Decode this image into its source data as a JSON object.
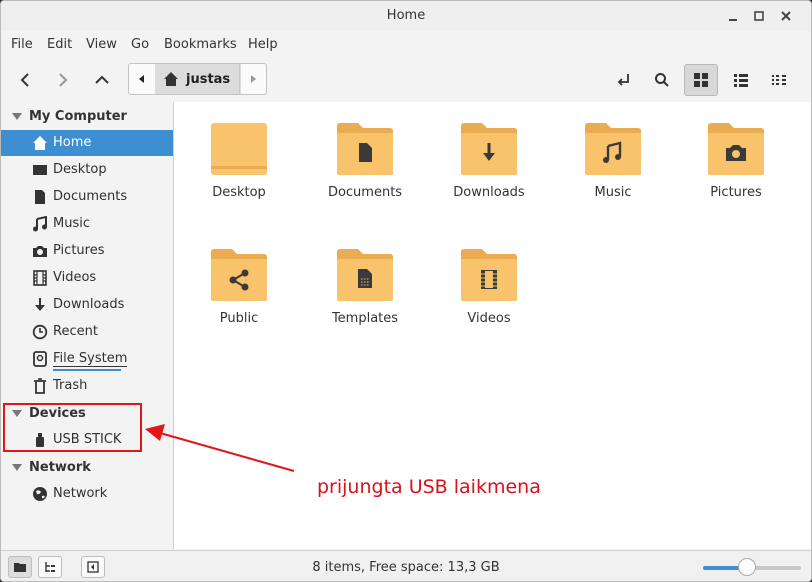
{
  "window": {
    "title": "Home"
  },
  "menubar": [
    "File",
    "Edit",
    "View",
    "Go",
    "Bookmarks",
    "Help"
  ],
  "pathbar": {
    "current": "justas"
  },
  "sidebar": {
    "sections": [
      {
        "title": "My Computer",
        "items": [
          {
            "label": "Home",
            "icon": "home-icon",
            "selected": true
          },
          {
            "label": "Desktop",
            "icon": "desktop-icon"
          },
          {
            "label": "Documents",
            "icon": "document-icon"
          },
          {
            "label": "Music",
            "icon": "music-icon"
          },
          {
            "label": "Pictures",
            "icon": "camera-icon"
          },
          {
            "label": "Videos",
            "icon": "film-icon"
          },
          {
            "label": "Downloads",
            "icon": "download-icon"
          },
          {
            "label": "Recent",
            "icon": "clock-icon"
          },
          {
            "label": "File System",
            "icon": "drive-icon"
          },
          {
            "label": "Trash",
            "icon": "trash-icon"
          }
        ]
      },
      {
        "title": "Devices",
        "items": [
          {
            "label": "USB STICK",
            "icon": "usb-icon"
          }
        ]
      },
      {
        "title": "Network",
        "items": [
          {
            "label": "Network",
            "icon": "globe-icon"
          }
        ]
      }
    ]
  },
  "files": [
    {
      "name": "Desktop",
      "emblem": "none"
    },
    {
      "name": "Documents",
      "emblem": "document"
    },
    {
      "name": "Downloads",
      "emblem": "download"
    },
    {
      "name": "Music",
      "emblem": "music"
    },
    {
      "name": "Pictures",
      "emblem": "camera"
    },
    {
      "name": "Public",
      "emblem": "share"
    },
    {
      "name": "Templates",
      "emblem": "template"
    },
    {
      "name": "Videos",
      "emblem": "film"
    }
  ],
  "status": {
    "text": "8 items, Free space: 13,3 GB",
    "zoom_level": 0.45
  },
  "annotation": {
    "text": "prijungta USB laikmena"
  },
  "colors": {
    "accent": "#3d8fd1",
    "folder": "#f8c36b",
    "folder_tab": "#e9ac52",
    "annotation": "#e2161a"
  }
}
